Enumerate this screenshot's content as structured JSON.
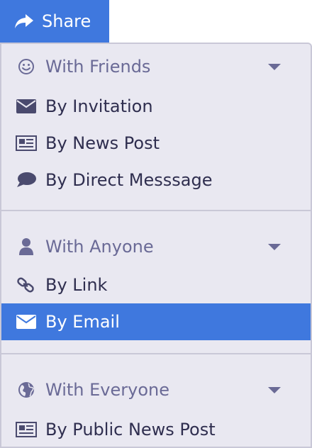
{
  "share_button": {
    "label": "Share",
    "icon": "share-icon"
  },
  "menu": {
    "sections": [
      {
        "header": {
          "label": "With Friends",
          "icon": "smiley-icon"
        },
        "items": [
          {
            "label": "By Invitation",
            "icon": "envelope-icon"
          },
          {
            "label": "By News Post",
            "icon": "newspaper-icon"
          },
          {
            "label": "By Direct Messsage",
            "icon": "chat-bubble-icon"
          }
        ]
      },
      {
        "header": {
          "label": "With Anyone",
          "icon": "user-icon"
        },
        "items": [
          {
            "label": "By Link",
            "icon": "link-icon"
          },
          {
            "label": "By Email",
            "icon": "envelope-icon",
            "selected": true
          }
        ]
      },
      {
        "header": {
          "label": "With Everyone",
          "icon": "globe-icon"
        },
        "items": [
          {
            "label": "By Public News Post",
            "icon": "newspaper-icon"
          }
        ]
      }
    ]
  },
  "colors": {
    "accent": "#3f78de",
    "menu_background": "#e9e8f1",
    "border": "#c9c8d7",
    "header_text": "#6a6a96",
    "item_text": "#2f2e4f"
  }
}
